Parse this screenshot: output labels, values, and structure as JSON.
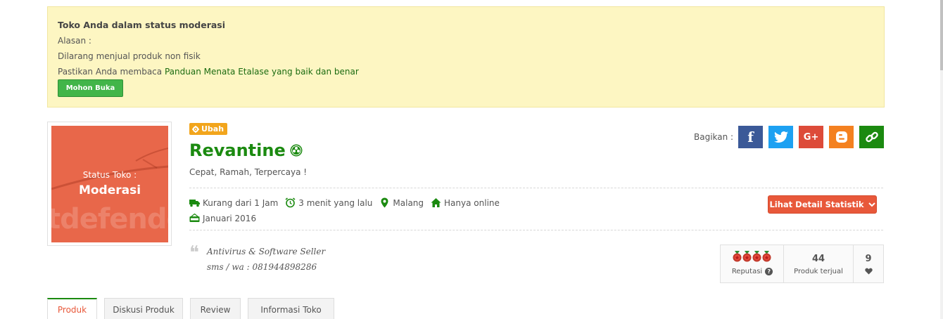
{
  "notice": {
    "title": "Toko Anda dalam status moderasi",
    "reason_label": "Alasan :",
    "reason": "Dilarang menjual produk non fisik",
    "instruction_prefix": "Pastikan Anda membaca",
    "instruction_link": "Panduan Menata Etalase yang baik dan benar",
    "button_label": "Mohon Buka"
  },
  "avatar": {
    "status_label": "Status Toko :",
    "status_value": "Moderasi",
    "watermark": "tdefende",
    "color": "#e8674a"
  },
  "shop": {
    "edit_label": "Ubah",
    "name": "Revantine",
    "tagline": "Cepat, Ramah, Terpercaya !",
    "delivery": "Kurang dari 1 Jam",
    "last_online": "3 menit yang lalu",
    "location": "Malang",
    "mode": "Hanya online",
    "opened": "Januari 2016",
    "description_line1": "Antivirus & Software Seller",
    "description_line2": "sms / wa : 081944898286",
    "name_color": "#1b8a10"
  },
  "share": {
    "label": "Bagikan :",
    "buttons": [
      {
        "icon": "facebook-icon",
        "glyph": "f",
        "color": "#3b5998"
      },
      {
        "icon": "twitter-icon",
        "glyph": "t",
        "color": "#1da1f2"
      },
      {
        "icon": "google-plus-icon",
        "glyph": "G+",
        "color": "#dd4b39"
      },
      {
        "icon": "blogger-icon",
        "glyph": "B",
        "color": "#f48120"
      },
      {
        "icon": "link-icon",
        "glyph": "",
        "color": "#1b8a10"
      }
    ]
  },
  "stats_button": {
    "label": "Lihat Detail Statistik"
  },
  "stats": {
    "reputation_label": "Reputasi",
    "sold_count": "44",
    "sold_label": "Produk terjual",
    "favorites": "9"
  },
  "tabs": [
    {
      "label": "Produk",
      "active": true
    },
    {
      "label": "Diskusi Produk",
      "active": false
    },
    {
      "label": "Review",
      "active": false
    },
    {
      "label": "Informasi Toko",
      "active": false
    }
  ]
}
